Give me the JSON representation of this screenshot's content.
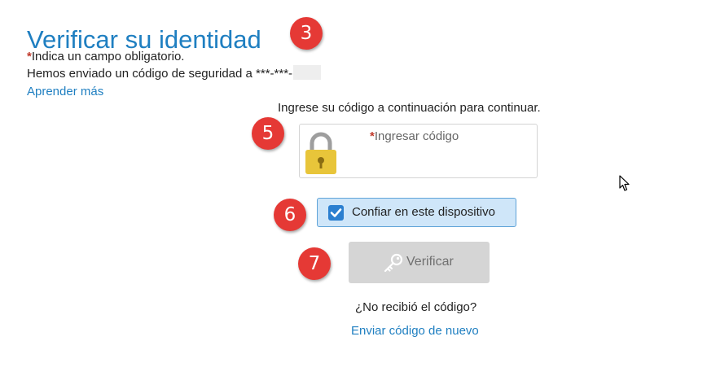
{
  "header": {
    "title": "Verificar su identidad"
  },
  "info": {
    "required_star": "*",
    "required_note": "Indica un campo obligatorio.",
    "sent_message": "Hemos enviado un código de seguridad a ***-***-",
    "learn_more": "Aprender más"
  },
  "form": {
    "instruction": "Ingrese su código a continuación para continuar.",
    "code_star": "*",
    "code_label": "Ingresar código",
    "code_value": "",
    "trust_label": "Confiar en este dispositivo",
    "trust_checked": true,
    "verify_label": "Verificar",
    "no_code": "¿No recibió el código?",
    "resend": "Enviar código de nuevo"
  },
  "annotations": {
    "step_3": "3",
    "step_5": "5",
    "step_6": "6",
    "step_7": "7"
  },
  "icons": {
    "lock": "lock-icon",
    "checkbox": "checkbox-checked-icon",
    "key": "key-icon",
    "cursor": "mouse-cursor-icon"
  },
  "colors": {
    "link": "#1f7fc1",
    "required": "#c0392b",
    "lock_body": "#e8c53a",
    "trust_bg": "#cfe6f9",
    "checkbox": "#2b7fd0",
    "verify_bg": "#d5d5d5",
    "badge": "#e53935"
  }
}
